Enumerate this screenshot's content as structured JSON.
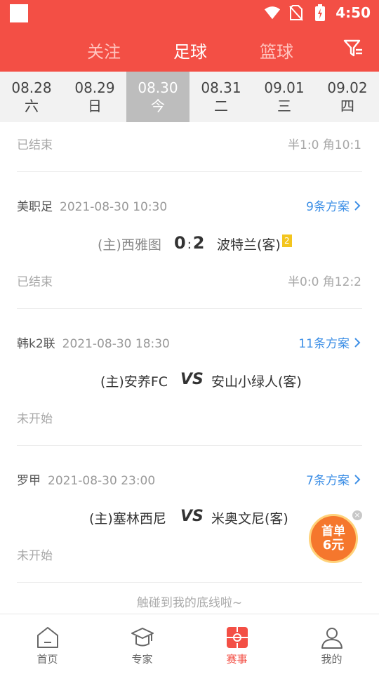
{
  "status": {
    "time": "4:50"
  },
  "header": {
    "tabs": [
      {
        "label": "关注"
      },
      {
        "label": "足球"
      },
      {
        "label": "篮球"
      }
    ]
  },
  "dates": [
    {
      "date": "08.28",
      "day": "六"
    },
    {
      "date": "08.29",
      "day": "日"
    },
    {
      "date": "08.30",
      "day": "今"
    },
    {
      "date": "08.31",
      "day": "二"
    },
    {
      "date": "09.01",
      "day": "三"
    },
    {
      "date": "09.02",
      "day": "四"
    }
  ],
  "matches": [
    {
      "status": "已结束",
      "stats": "半1:0 角10:1"
    },
    {
      "league": "美职足",
      "time": "2021-08-30 10:30",
      "plans": "9条方案",
      "home": "(主)西雅图",
      "score_home": "0",
      "score_sep": ":",
      "score_away": "2",
      "away": "波特兰(客)",
      "away_card": "2",
      "status": "已结束",
      "stats": "半0:0 角12:2"
    },
    {
      "league": "韩k2联",
      "time": "2021-08-30 18:30",
      "plans": "11条方案",
      "home": "(主)安养FC",
      "vs": "VS",
      "away": "安山小绿人(客)",
      "status": "未开始"
    },
    {
      "league": "罗甲",
      "time": "2021-08-30 23:00",
      "plans": "7条方案",
      "home": "(主)塞林西尼",
      "vs": "VS",
      "away": "米奥文尼(客)",
      "status": "未开始"
    }
  ],
  "footer_note": "触碰到我的底线啦~",
  "promo": {
    "line1": "首单",
    "line2": "6元"
  },
  "nav": [
    {
      "label": "首页"
    },
    {
      "label": "专家"
    },
    {
      "label": "赛事"
    },
    {
      "label": "我的"
    }
  ],
  "colors": {
    "brand": "#f34f45",
    "link": "#3d8fe6",
    "promo": "#f5772d"
  }
}
